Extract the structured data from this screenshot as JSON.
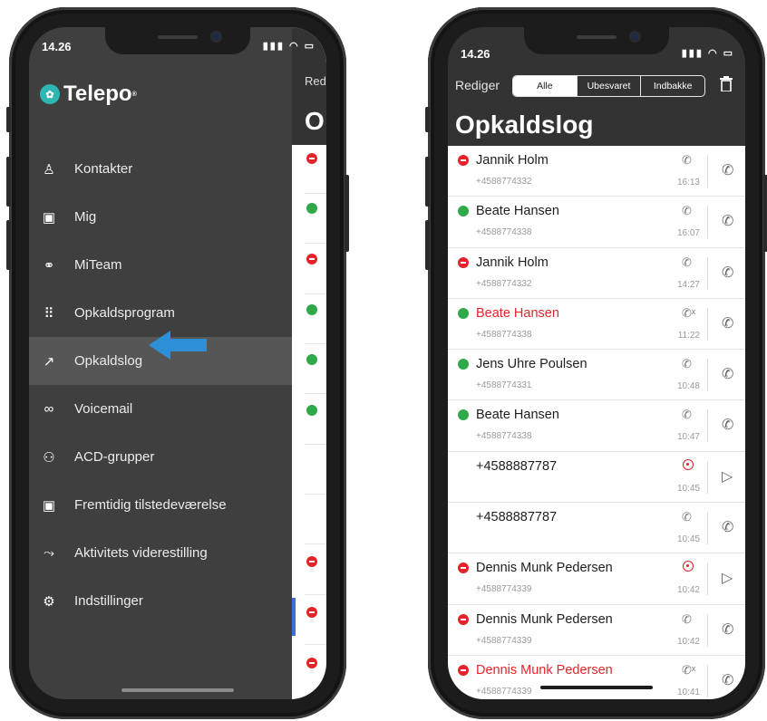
{
  "left_phone": {
    "status_time": "14.26",
    "status_icons": "▮▮▮ ◠ ▭",
    "brand": {
      "name": "Telepo",
      "mark": "®"
    },
    "menu": [
      {
        "label": "Kontakter",
        "icon": "person-icon",
        "glyph": "♙"
      },
      {
        "label": "Mig",
        "icon": "id-card-icon",
        "glyph": "▣"
      },
      {
        "label": "MiTeam",
        "icon": "team-icon",
        "glyph": "⚭"
      },
      {
        "label": "Opkaldsprogram",
        "icon": "keypad-icon",
        "glyph": "⠿"
      },
      {
        "label": "Opkaldslog",
        "icon": "call-log-icon",
        "glyph": "↗"
      },
      {
        "label": "Voicemail",
        "icon": "voicemail-icon",
        "glyph": "∞"
      },
      {
        "label": "ACD-grupper",
        "icon": "acd-group-icon",
        "glyph": "⚇"
      },
      {
        "label": "Fremtidig tilstedeværelse",
        "icon": "calendar-icon",
        "glyph": "▣"
      },
      {
        "label": "Aktivitets viderestilling",
        "icon": "forward-icon",
        "glyph": "⤳"
      },
      {
        "label": "Indstillinger",
        "icon": "gear-icon",
        "glyph": "⚙"
      }
    ],
    "active_item": "Opkaldslog",
    "behind_header": {
      "truncated_label": "Red",
      "truncated_title": "O"
    },
    "accent": "#2d8fd5"
  },
  "right_phone": {
    "status_time": "14.26",
    "status_icons": "▮▮▮ ◠ ▭",
    "header": {
      "edit_label": "Rediger",
      "tabs": [
        "Alle",
        "Ubesvaret",
        "Indbakke"
      ],
      "selected_tab": "Alle",
      "title": "Opkaldslog"
    },
    "calls": [
      {
        "name": "Jannik Holm",
        "number": "+4588774332",
        "time": "16:13",
        "status": "red",
        "missed": false,
        "direction_icon": "outgoing-call-icon",
        "action": "call"
      },
      {
        "name": "Beate Hansen",
        "number": "+4588774338",
        "time": "16:07",
        "status": "green",
        "missed": false,
        "direction_icon": "incoming-call-icon",
        "action": "call"
      },
      {
        "name": "Jannik Holm",
        "number": "+4588774332",
        "time": "14:27",
        "status": "red",
        "missed": false,
        "direction_icon": "outgoing-call-icon",
        "action": "call"
      },
      {
        "name": "Beate Hansen",
        "number": "+4588774338",
        "time": "11:22",
        "status": "green",
        "missed": true,
        "direction_icon": "missed-call-icon",
        "action": "call"
      },
      {
        "name": "Jens Uhre Poulsen",
        "number": "+4588774331",
        "time": "10:48",
        "status": "green",
        "missed": false,
        "direction_icon": "outgoing-call-icon",
        "action": "call"
      },
      {
        "name": "Beate Hansen",
        "number": "+4588774338",
        "time": "10:47",
        "status": "green",
        "missed": false,
        "direction_icon": "incoming-call-icon",
        "action": "call"
      },
      {
        "name": "+4588887787",
        "number": "",
        "time": "10:45",
        "status": "none",
        "missed": false,
        "direction_icon": "record-icon",
        "action": "play"
      },
      {
        "name": "+4588887787",
        "number": "",
        "time": "10:45",
        "status": "none",
        "missed": false,
        "direction_icon": "incoming-call-icon",
        "action": "call"
      },
      {
        "name": "Dennis Munk Pedersen",
        "number": "+4588774339",
        "time": "10:42",
        "status": "red",
        "missed": false,
        "direction_icon": "record-icon",
        "action": "play"
      },
      {
        "name": "Dennis Munk Pedersen",
        "number": "+4588774339",
        "time": "10:42",
        "status": "red",
        "missed": false,
        "direction_icon": "incoming-call-icon",
        "action": "call"
      },
      {
        "name": "Dennis Munk Pedersen",
        "number": "+4588774339",
        "time": "10:41",
        "status": "red",
        "missed": true,
        "direction_icon": "missed-call-icon",
        "action": "call"
      }
    ],
    "colors": {
      "available": "#2faa4a",
      "busy": "#e3242b",
      "missed_text": "#e3242b"
    }
  }
}
